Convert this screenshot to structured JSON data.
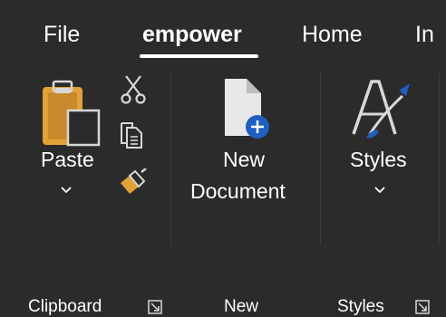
{
  "tabs": [
    {
      "label": "File",
      "active": false
    },
    {
      "label": "empower",
      "active": true
    },
    {
      "label": "Home",
      "active": false
    },
    {
      "label": "In",
      "active": false
    }
  ],
  "clipboard": {
    "paste_label": "Paste",
    "group_label": "Clipboard",
    "icons": [
      "paste-icon",
      "cut-icon",
      "copy-icon",
      "format-painter-icon",
      "dropdown-chevron-icon",
      "dialog-launcher-icon"
    ]
  },
  "new": {
    "new_document_line1": "New",
    "new_document_line2": "Document",
    "group_label": "New",
    "icons": [
      "new-document-icon"
    ]
  },
  "styles": {
    "styles_label": "Styles",
    "group_label": "Styles",
    "icons": [
      "styles-icon",
      "dropdown-chevron-icon",
      "dialog-launcher-icon"
    ]
  },
  "colors": {
    "background": "#2b2b2b",
    "accent_blue": "#1f5fbf",
    "clipboard_orange": "#e3a13a",
    "text": "#ffffff"
  }
}
